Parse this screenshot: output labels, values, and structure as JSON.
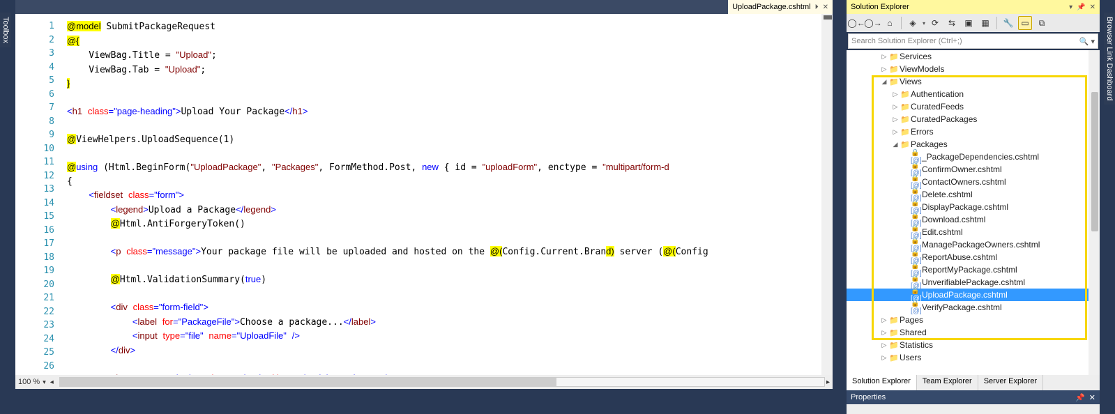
{
  "sidetabs": {
    "left": "Toolbox",
    "right": "Browser Link Dashboard"
  },
  "editor": {
    "tab": {
      "name": "UploadPackage.cshtml",
      "pin": "⏵",
      "close": "✕"
    },
    "zoom": "100 %",
    "lines": [
      "1",
      "2",
      "3",
      "4",
      "5",
      "6",
      "7",
      "8",
      "9",
      "10",
      "11",
      "12",
      "13",
      "14",
      "15",
      "16",
      "17",
      "18",
      "19",
      "20",
      "21",
      "22",
      "23",
      "24",
      "25",
      "26"
    ]
  },
  "se": {
    "title": "Solution Explorer",
    "search_placeholder": "Search Solution Explorer (Ctrl+;)",
    "tabs": [
      "Solution Explorer",
      "Team Explorer",
      "Server Explorer"
    ],
    "props_title": "Properties",
    "nodes": [
      {
        "d": 3,
        "t": "folder",
        "a": "▷",
        "n": "Services"
      },
      {
        "d": 3,
        "t": "folder",
        "a": "▷",
        "n": "ViewModels"
      },
      {
        "d": 3,
        "t": "folder",
        "a": "◢",
        "n": "Views"
      },
      {
        "d": 4,
        "t": "folder",
        "a": "▷",
        "n": "Authentication"
      },
      {
        "d": 4,
        "t": "folder",
        "a": "▷",
        "n": "CuratedFeeds"
      },
      {
        "d": 4,
        "t": "folder",
        "a": "▷",
        "n": "CuratedPackages"
      },
      {
        "d": 4,
        "t": "folder",
        "a": "▷",
        "n": "Errors"
      },
      {
        "d": 4,
        "t": "folder",
        "a": "◢",
        "n": "Packages"
      },
      {
        "d": 5,
        "t": "file",
        "n": "_PackageDependencies.cshtml"
      },
      {
        "d": 5,
        "t": "file",
        "n": "ConfirmOwner.cshtml"
      },
      {
        "d": 5,
        "t": "file",
        "n": "ContactOwners.cshtml"
      },
      {
        "d": 5,
        "t": "file",
        "n": "Delete.cshtml"
      },
      {
        "d": 5,
        "t": "file",
        "n": "DisplayPackage.cshtml"
      },
      {
        "d": 5,
        "t": "file",
        "n": "Download.cshtml"
      },
      {
        "d": 5,
        "t": "file",
        "n": "Edit.cshtml"
      },
      {
        "d": 5,
        "t": "file",
        "n": "ManagePackageOwners.cshtml"
      },
      {
        "d": 5,
        "t": "file",
        "n": "ReportAbuse.cshtml"
      },
      {
        "d": 5,
        "t": "file",
        "n": "ReportMyPackage.cshtml"
      },
      {
        "d": 5,
        "t": "file",
        "n": "UnverifiablePackage.cshtml"
      },
      {
        "d": 5,
        "t": "file",
        "n": "UploadPackage.cshtml",
        "sel": true
      },
      {
        "d": 5,
        "t": "file",
        "n": "VerifyPackage.cshtml"
      },
      {
        "d": 3,
        "t": "folder",
        "a": "▷",
        "n": "Pages"
      },
      {
        "d": 3,
        "t": "folder",
        "a": "▷",
        "n": "Shared"
      },
      {
        "d": 3,
        "t": "folder",
        "a": "▷",
        "n": "Statistics"
      },
      {
        "d": 3,
        "t": "folder",
        "a": "▷",
        "n": "Users"
      }
    ]
  }
}
